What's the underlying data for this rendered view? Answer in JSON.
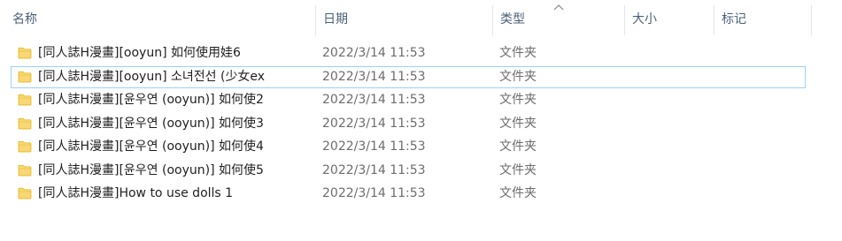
{
  "header": {
    "name_label": "名称",
    "date_label": "日期",
    "type_label": "类型",
    "size_label": "大小",
    "tags_label": "标记"
  },
  "colors": {
    "folder": "#f8d775",
    "folder_dark": "#e0b000",
    "focus_border": "#99d1ff",
    "header_text": "#4c607a"
  },
  "rows": [
    {
      "name": "[同人誌H漫畫][ooyun] 如何使用娃6",
      "date": "2022/3/14 11:53",
      "type": "文件夹"
    },
    {
      "name": "[同人誌H漫畫][ooyun] 소녀전선 (少女ex",
      "date": "2022/3/14 11:53",
      "type": "文件夹"
    },
    {
      "name": "[同人誌H漫畫][윤우연 (ooyun)] 如何使2",
      "date": "2022/3/14 11:53",
      "type": "文件夹"
    },
    {
      "name": "[同人誌H漫畫][윤우연 (ooyun)] 如何使3",
      "date": "2022/3/14 11:53",
      "type": "文件夹"
    },
    {
      "name": "[同人誌H漫畫][윤우연 (ooyun)] 如何使4",
      "date": "2022/3/14 11:53",
      "type": "文件夹"
    },
    {
      "name": "[同人誌H漫畫][윤우연 (ooyun)] 如何使5",
      "date": "2022/3/14 11:53",
      "type": "文件夹"
    },
    {
      "name": "[同人誌H漫畫]How to use dolls 1",
      "date": "2022/3/14 11:53",
      "type": "文件夹"
    }
  ]
}
